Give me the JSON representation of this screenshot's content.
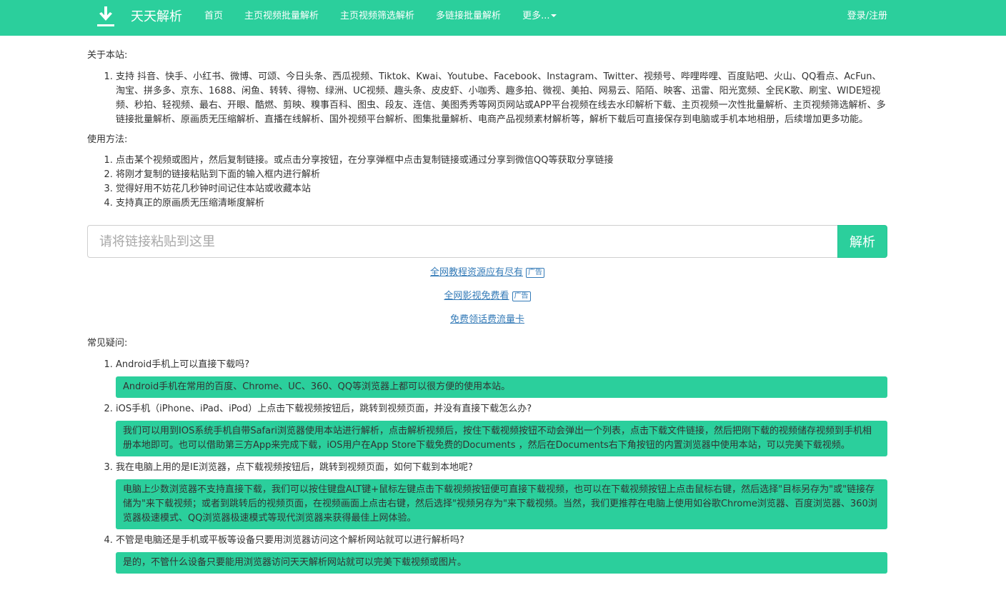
{
  "nav": {
    "brand": "天天解析",
    "links": [
      "首页",
      "主页视频批量解析",
      "主页视频筛选解析",
      "多链接批量解析"
    ],
    "more": "更多...",
    "login": "登录/注册"
  },
  "about": {
    "title": "关于本站:",
    "items": [
      "支持 抖音、快手、小红书、微博、可颂、今日头条、西瓜视频、Tiktok、Kwai、Youtube、Facebook、Instagram、Twitter、视频号、哔哩哔哩、百度贴吧、火山、QQ看点、AcFun、淘宝、拼多多、京东、1688、闲鱼、转转、得物、绿洲、UC视频、趣头条、皮皮虾、小咖秀、趣多拍、微视、美拍、网易云、陌陌、映客、迅雷、阳光宽频、全民K歌、刷宝、WIDE短视频、秒拍、轻视频、最右、开眼、酷燃、剪映、糗事百科、图虫、段友、连信、美图秀秀等网页网站或APP平台视频在线去水印解析下载、主页视频一次性批量解析、主页视频筛选解析、多链接批量解析、原画质无压缩解析、直播在线解析、国外视频平台解析、图集批量解析、电商产品视频素材解析等，解析下载后可直接保存到电脑或手机本地相册，后续增加更多功能。"
    ]
  },
  "usage": {
    "title": "使用方法:",
    "items": [
      "点击某个视频或图片，然后复制链接。或点击分享按钮，在分享弹框中点击复制链接或通过分享到微信QQ等获取分享链接",
      "将刚才复制的链接粘贴到下面的输入框内进行解析",
      "觉得好用不妨花几秒钟时间记住本站或收藏本站",
      "支持真正的原画质无压缩清晰度解析"
    ]
  },
  "search": {
    "placeholder": "请将链接粘贴到这里",
    "value": "",
    "button": "解析"
  },
  "promo": {
    "ad_label": "广告",
    "links": [
      "全网教程资源应有尽有",
      "全网影视免费看",
      "免费领话费流量卡"
    ]
  },
  "faq": {
    "title": "常见疑问:",
    "items": [
      {
        "q": "Android手机上可以直接下载吗?",
        "a": "Android手机在常用的百度、Chrome、UC、360、QQ等浏览器上都可以很方便的使用本站。"
      },
      {
        "q": "iOS手机（iPhone、iPad、iPod）上点击下载视频按钮后，跳转到视频页面，并没有直接下载怎么办?",
        "a": "我们可以用到IOS系统手机自带Safari浏览器使用本站进行解析，点击解析视频后，按住下载视频按钮不动会弹出一个列表，点击下载文件链接，然后把刚下载的视频储存视频到手机相册本地即可。也可以借助第三方App来完成下载，iOS用户在App Store下载免费的Documents ，然后在Documents右下角按钮的内置浏览器中使用本站，可以完美下载视频。"
      },
      {
        "q": "我在电脑上用的是IE浏览器，点下载视频按钮后，跳转到视频页面，如何下载到本地呢?",
        "a": "电脑上少数浏览器不支持直接下载，我们可以按住键盘ALT键+鼠标左键点击下载视频按钮便可直接下载视频，也可以在下载视频按钮上点击鼠标右键，然后选择\"目标另存为\"或\"链接存储为\"来下载视频；或者到跳转后的视频页面，在视频画面上点击右键，然后选择\"视频另存为\"来下载视频。当然，我们更推荐在电脑上使用如谷歌Chrome浏览器、百度浏览器、360浏览器极速模式、QQ浏览器极速模式等现代浏览器来获得最佳上网体验。"
      },
      {
        "q": "不管是电脑还是手机或平板等设备只要用浏览器访问这个解析网站就可以进行解析吗?",
        "a": "是的，不管什么设备只要能用浏览器访问天天解析网站就可以完美下载视频或图片。"
      }
    ]
  },
  "colors": {
    "brand": "#2bcf9c",
    "link": "#337ab7"
  },
  "icons": {
    "logo": "download-icon",
    "more": "caret-down-icon"
  }
}
